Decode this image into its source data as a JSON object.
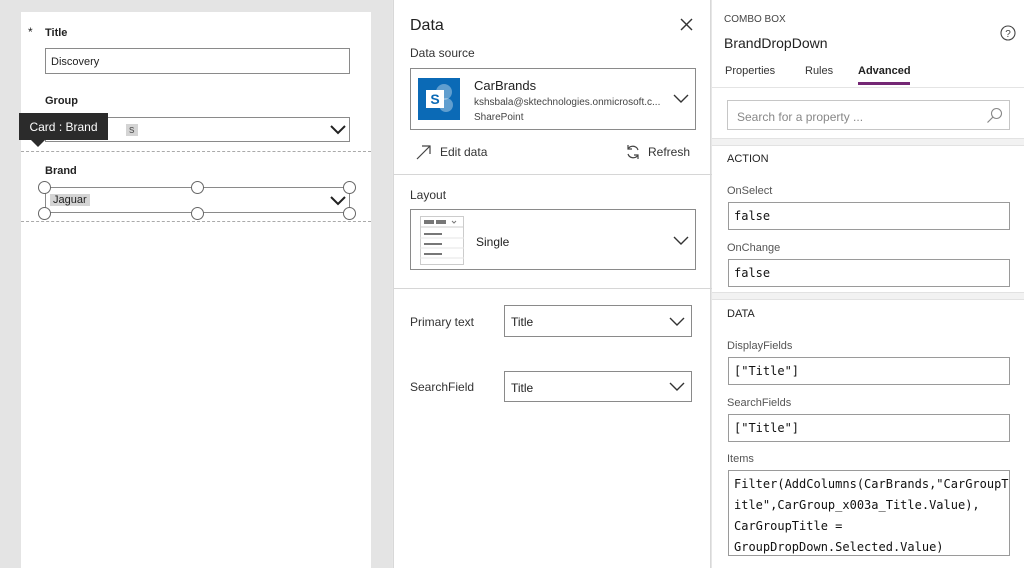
{
  "form": {
    "title_required_mark": "*",
    "title_label": "Title",
    "title_value": "Discovery",
    "group_label": "Group",
    "group_value": "s",
    "brand_label": "Brand",
    "brand_value": "Jaguar",
    "tooltip": "Card : Brand"
  },
  "data_panel": {
    "heading": "Data",
    "datasource_label": "Data source",
    "datasource": {
      "name": "CarBrands",
      "account": "kshsbala@sktechnologies.onmicrosoft.c...",
      "type": "SharePoint"
    },
    "edit_data": "Edit data",
    "refresh": "Refresh",
    "layout_label": "Layout",
    "layout_value": "Single",
    "primary_text_label": "Primary text",
    "primary_text_value": "Title",
    "searchfield_label": "SearchField",
    "searchfield_value": "Title"
  },
  "props_panel": {
    "control_type": "COMBO BOX",
    "control_name": "BrandDropDown",
    "tabs": [
      "Properties",
      "Rules",
      "Advanced"
    ],
    "search_placeholder": "Search for a property ...",
    "action_heading": "ACTION",
    "onselect_label": "OnSelect",
    "onselect_value": "false",
    "onchange_label": "OnChange",
    "onchange_value": "false",
    "data_heading": "DATA",
    "displayfields_label": "DisplayFields",
    "displayfields_value": "[\"Title\"]",
    "searchfields_label": "SearchFields",
    "searchfields_value": "[\"Title\"]",
    "items_label": "Items",
    "items_lines": [
      "Filter(AddColumns(CarBrands,\"CarGroupT",
      "itle\",CarGroup_x003a_Title.Value),",
      "CarGroupTitle =",
      "GroupDropDown.Selected.Value)"
    ]
  },
  "colors": {
    "accent_tab_underline": "#742774",
    "sharepoint_blue": "#0b6ab6",
    "tooltip_bg": "#2b2b2b"
  }
}
